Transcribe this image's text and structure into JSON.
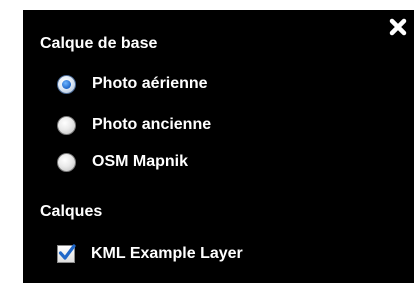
{
  "panel": {
    "close_icon": "close-icon"
  },
  "base_layers": {
    "title": "Calque de base",
    "options": [
      {
        "label": "Photo aérienne",
        "checked": true
      },
      {
        "label": "Photo ancienne",
        "checked": false
      },
      {
        "label": "OSM Mapnik",
        "checked": false
      }
    ]
  },
  "overlays": {
    "title": "Calques",
    "options": [
      {
        "label": "KML Example Layer",
        "checked": true
      }
    ]
  },
  "colors": {
    "panel_background": "#000000",
    "text": "#ffffff",
    "radio_selected": "#1f67c9",
    "checkbox_check": "#1f67c9"
  }
}
